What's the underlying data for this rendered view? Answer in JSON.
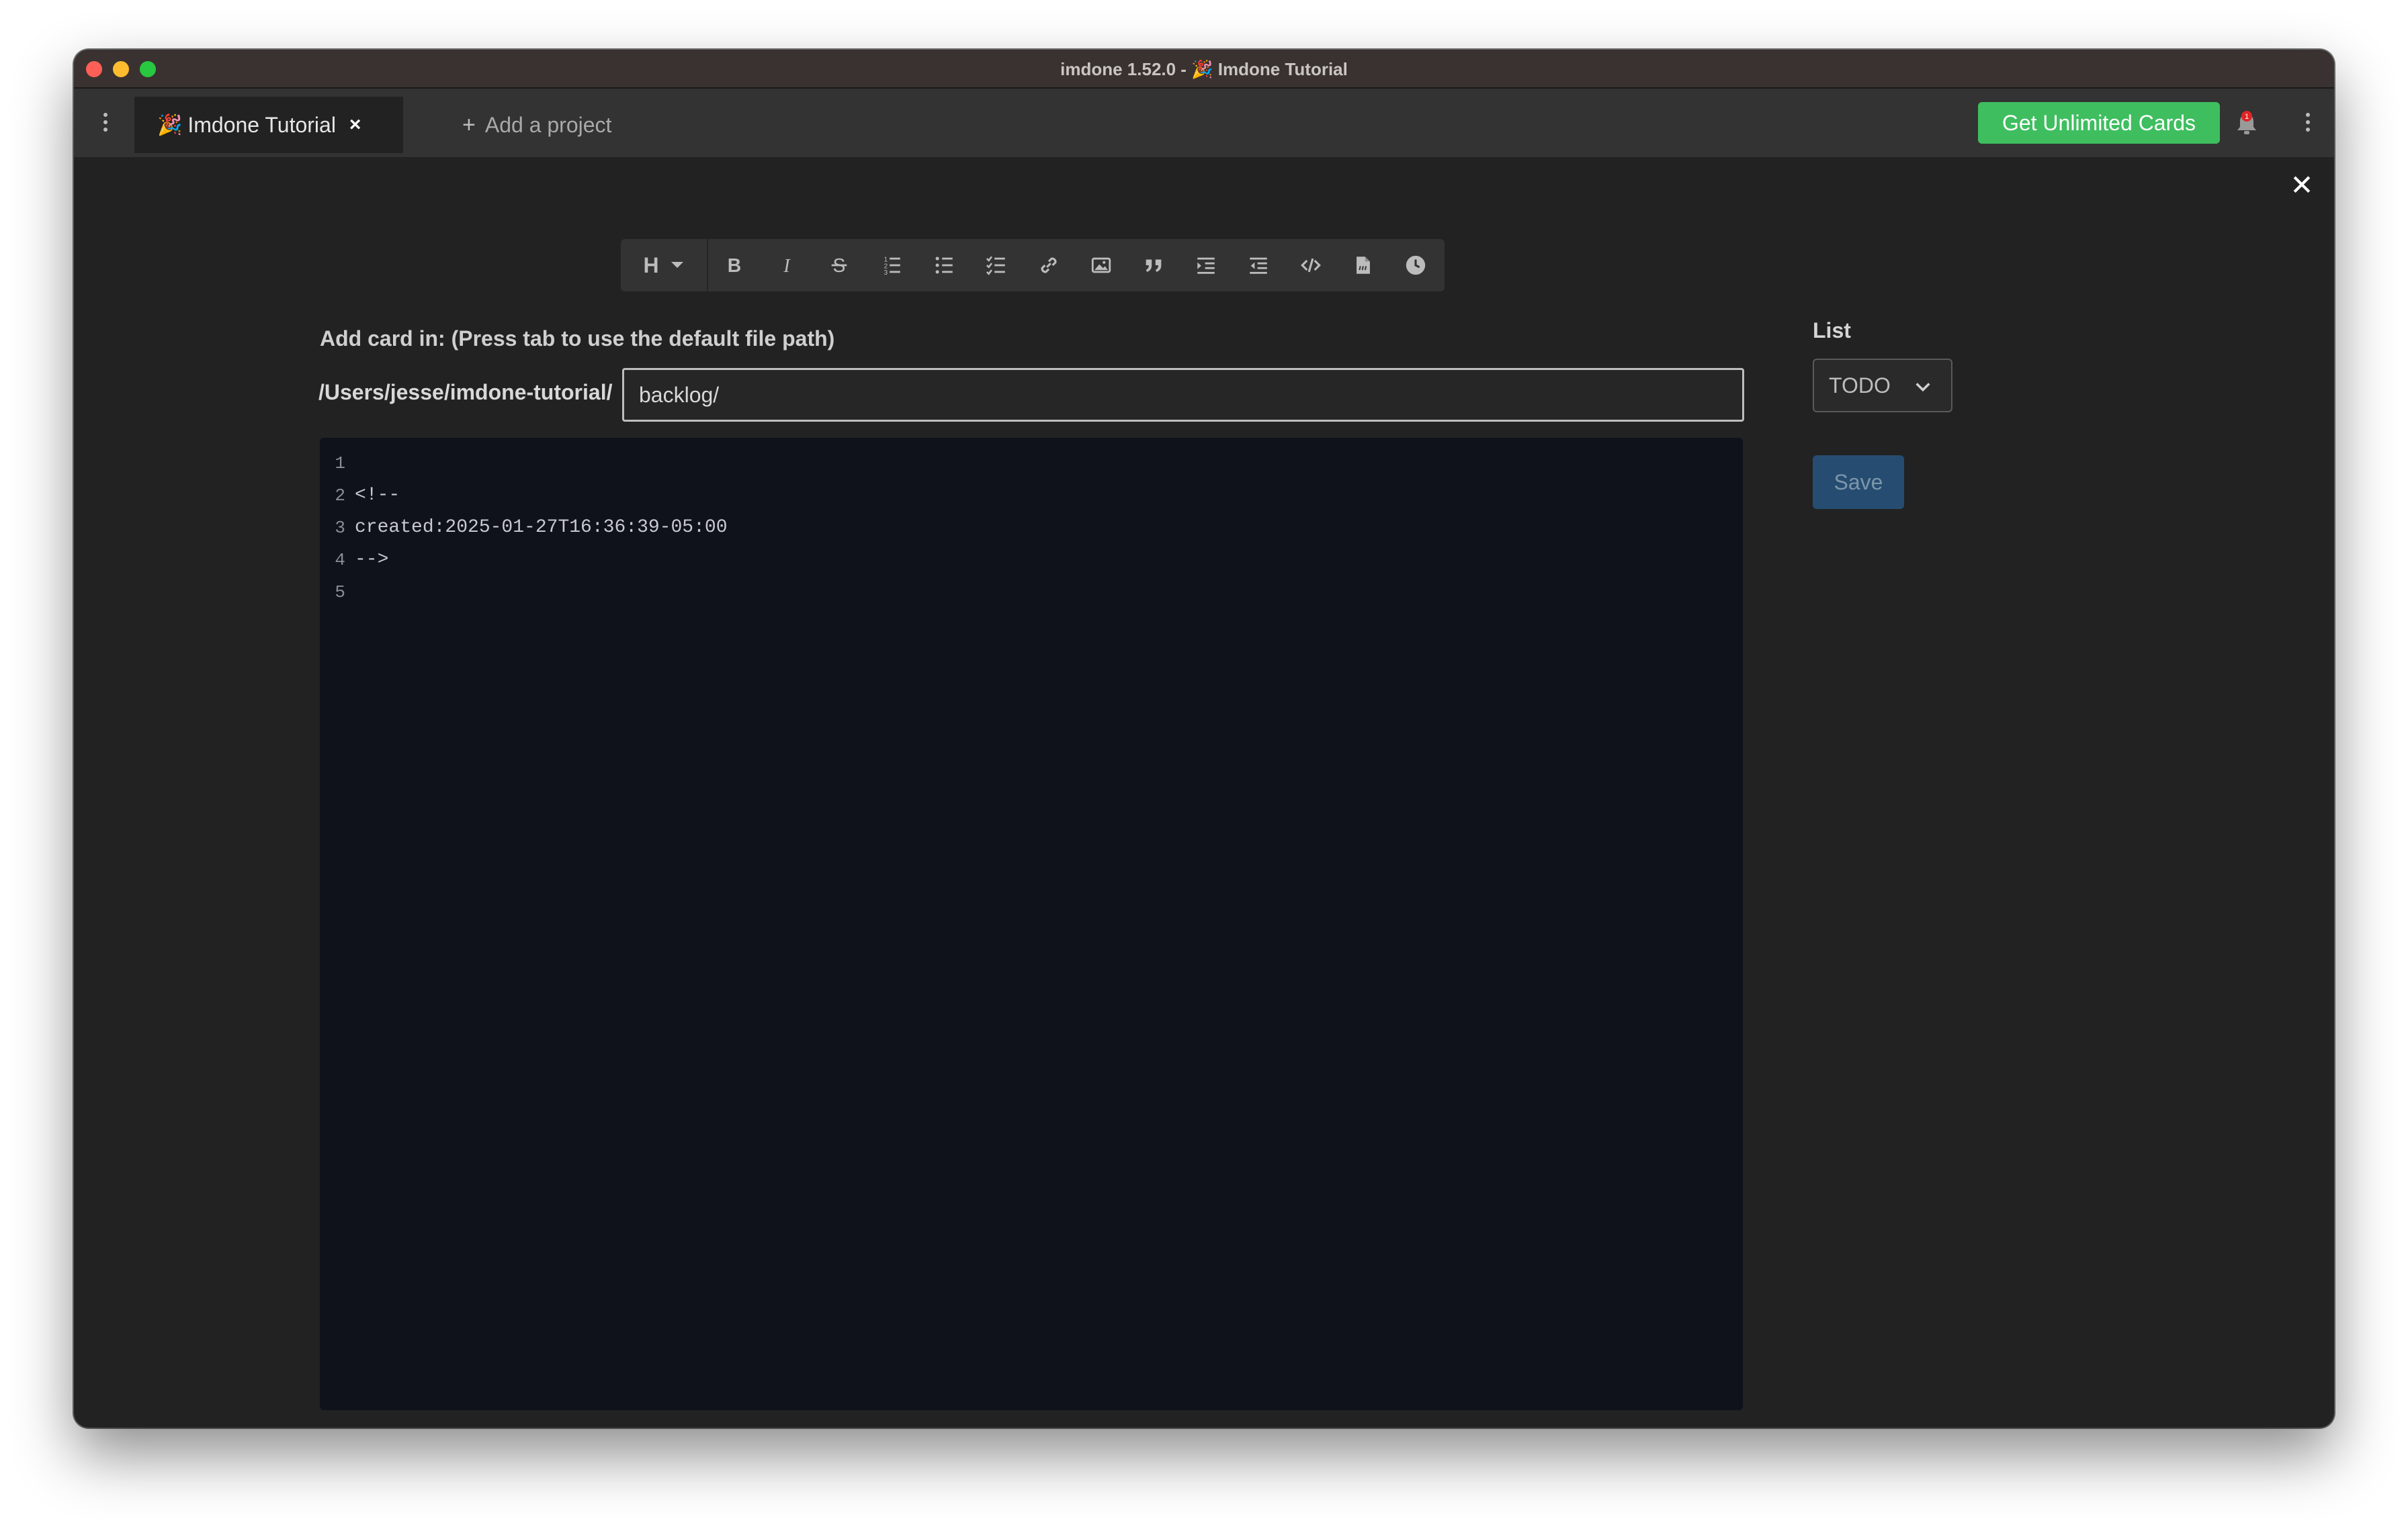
{
  "window": {
    "title": "imdone 1.52.0 - 🎉 Imdone Tutorial"
  },
  "tabs": {
    "active": {
      "emoji": "🎉",
      "label": "Imdone Tutorial",
      "close_glyph": "×"
    },
    "add_project": {
      "label": "Add a project"
    }
  },
  "header": {
    "unlimited_label": "Get Unlimited Cards",
    "notification_count": "1"
  },
  "editor_toolbar": {
    "heading_label": "H",
    "buttons": [
      "heading-dropdown",
      "bold",
      "italic",
      "strikethrough",
      "ordered-list",
      "unordered-list",
      "task-list",
      "link",
      "image",
      "quote",
      "indent",
      "outdent",
      "code",
      "insert-file",
      "timestamp"
    ]
  },
  "form": {
    "hint": "Add card in: (Press tab to use the default file path)",
    "path_prefix": "/Users/jesse/imdone-tutorial/",
    "path_value": "backlog/"
  },
  "editor": {
    "lines": [
      {
        "num": "1",
        "text": ""
      },
      {
        "num": "2",
        "text": "<!--"
      },
      {
        "num": "3",
        "text": "created:2025-01-27T16:36:39-05:00"
      },
      {
        "num": "4",
        "text": "-->"
      },
      {
        "num": "5",
        "text": ""
      }
    ]
  },
  "sidebar": {
    "list_label": "List",
    "list_value": "TODO",
    "save_label": "Save"
  },
  "colors": {
    "accent_green": "#3fbe5f",
    "save_blue": "#264d71",
    "editor_bg": "#0f111b",
    "window_bg": "#222222"
  }
}
